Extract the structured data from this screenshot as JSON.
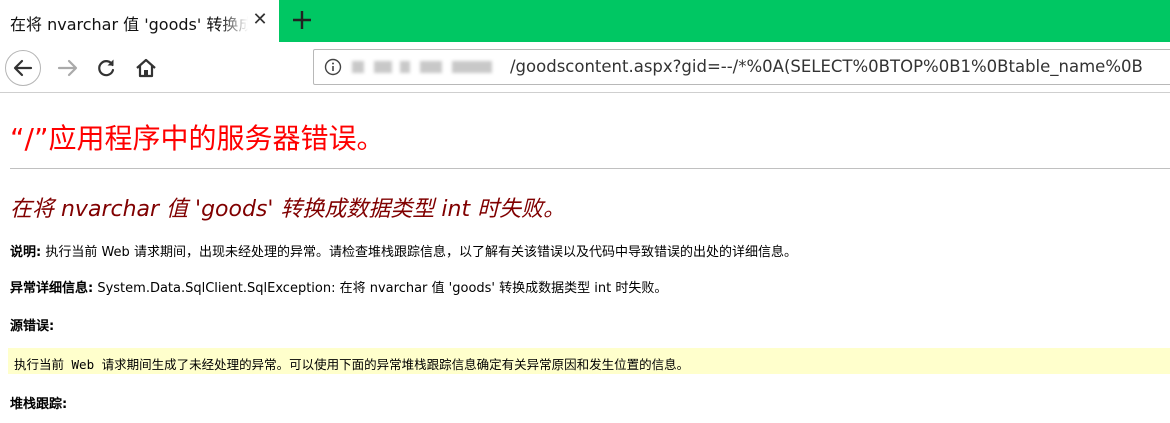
{
  "browser": {
    "tab_title": "在将 nvarchar 值 'goods' 转换成数",
    "url": "/goodscontent.aspx?gid=--/*%0A(SELECT%0BTOP%0B1%0Btable_name%0B",
    "icons": {
      "close": "close-icon",
      "new_tab": "plus-icon",
      "back": "back-arrow-icon",
      "forward": "forward-arrow-icon",
      "reload": "reload-icon",
      "home": "home-icon",
      "info": "info-icon"
    },
    "colors": {
      "tabstrip": "#00c763"
    }
  },
  "page": {
    "title": "“/”应用程序中的服务器错误。",
    "error_title": "在将 nvarchar 值 'goods' 转换成数据类型 int 时失败。",
    "description_label": "说明:",
    "description_text": " 执行当前 Web 请求期间，出现未经处理的异常。请检查堆栈跟踪信息，以了解有关该错误以及代码中导致错误的出处的详细信息。",
    "exception_label": "异常详细信息:",
    "exception_text": " System.Data.SqlClient.SqlException: 在将 nvarchar 值 'goods' 转换成数据类型 int 时失败。",
    "source_error_label": "源错误:",
    "source_error_text": "执行当前 Web 请求期间生成了未经处理的异常。可以使用下面的异常堆栈跟踪信息确定有关异常原因和发生位置的信息。",
    "stack_trace_label": "堆栈跟踪:",
    "colors": {
      "title": "#ff0000",
      "error_title": "#800000",
      "source_bg": "#ffffcc"
    }
  }
}
